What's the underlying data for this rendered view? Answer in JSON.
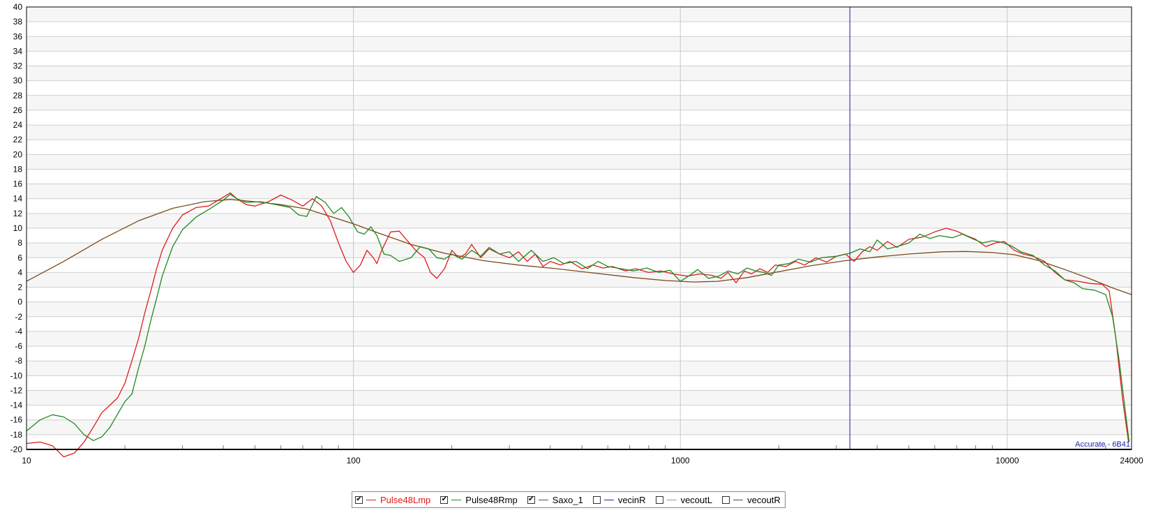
{
  "chart_data": {
    "type": "line",
    "title": "",
    "xlabel": "",
    "ylabel": "",
    "x_scale": "log",
    "xlim": [
      10,
      24000
    ],
    "ylim": [
      -20,
      40
    ],
    "grid": true,
    "x_ticks": [
      "10",
      "100",
      "1000",
      "10000",
      "24000"
    ],
    "y_ticks": [
      "40",
      "38",
      "36",
      "34",
      "32",
      "30",
      "28",
      "26",
      "24",
      "22",
      "20",
      "18",
      "16",
      "14",
      "12",
      "10",
      "8",
      "6",
      "4",
      "2",
      "0",
      "-2",
      "-4",
      "-6",
      "-8",
      "-10",
      "-12",
      "-14",
      "-16",
      "-18",
      "-20"
    ],
    "cursor_x": 3300,
    "watermark": "Accurate - 6B41",
    "series": [
      {
        "name": "Pulse48Lmp",
        "color": "#e01b1b",
        "checked": true,
        "points": [
          [
            10,
            -19.2
          ],
          [
            11,
            -19
          ],
          [
            12,
            -19.5
          ],
          [
            13,
            -21
          ],
          [
            14,
            -20.5
          ],
          [
            15,
            -19
          ],
          [
            16,
            -17
          ],
          [
            17,
            -15
          ],
          [
            18,
            -14
          ],
          [
            19,
            -13
          ],
          [
            20,
            -11
          ],
          [
            21,
            -8
          ],
          [
            22,
            -5
          ],
          [
            23,
            -1.5
          ],
          [
            24,
            1.5
          ],
          [
            25,
            4.5
          ],
          [
            26,
            7
          ],
          [
            28,
            10
          ],
          [
            30,
            11.8
          ],
          [
            33,
            12.8
          ],
          [
            36,
            13
          ],
          [
            40,
            14.2
          ],
          [
            42,
            14.8
          ],
          [
            44,
            14
          ],
          [
            47,
            13.2
          ],
          [
            50,
            13
          ],
          [
            55,
            13.6
          ],
          [
            60,
            14.5
          ],
          [
            65,
            13.8
          ],
          [
            70,
            13
          ],
          [
            75,
            14
          ],
          [
            80,
            13
          ],
          [
            85,
            11
          ],
          [
            90,
            8
          ],
          [
            95,
            5.5
          ],
          [
            100,
            4
          ],
          [
            105,
            5
          ],
          [
            110,
            7
          ],
          [
            115,
            6
          ],
          [
            118,
            5.2
          ],
          [
            122,
            7
          ],
          [
            130,
            9.5
          ],
          [
            138,
            9.6
          ],
          [
            145,
            8.5
          ],
          [
            155,
            7
          ],
          [
            165,
            6
          ],
          [
            172,
            4
          ],
          [
            180,
            3.2
          ],
          [
            190,
            4.5
          ],
          [
            200,
            7
          ],
          [
            210,
            6
          ],
          [
            220,
            6.5
          ],
          [
            230,
            7.8
          ],
          [
            245,
            6
          ],
          [
            260,
            7.2
          ],
          [
            280,
            6.5
          ],
          [
            300,
            6
          ],
          [
            320,
            6.8
          ],
          [
            340,
            5.5
          ],
          [
            360,
            6.5
          ],
          [
            380,
            4.8
          ],
          [
            400,
            5.5
          ],
          [
            430,
            5
          ],
          [
            460,
            5.5
          ],
          [
            500,
            4.5
          ],
          [
            540,
            5
          ],
          [
            580,
            4.6
          ],
          [
            620,
            4.8
          ],
          [
            680,
            4.2
          ],
          [
            730,
            4.5
          ],
          [
            800,
            4
          ],
          [
            870,
            4.2
          ],
          [
            950,
            3.8
          ],
          [
            1050,
            3.5
          ],
          [
            1150,
            3.8
          ],
          [
            1250,
            3.6
          ],
          [
            1330,
            3.2
          ],
          [
            1400,
            4
          ],
          [
            1480,
            2.6
          ],
          [
            1570,
            4.2
          ],
          [
            1650,
            3.8
          ],
          [
            1750,
            4.5
          ],
          [
            1850,
            4
          ],
          [
            1950,
            5
          ],
          [
            2100,
            4.8
          ],
          [
            2250,
            5.5
          ],
          [
            2400,
            5
          ],
          [
            2600,
            6
          ],
          [
            2800,
            5.4
          ],
          [
            3000,
            6.2
          ],
          [
            3200,
            6.5
          ],
          [
            3400,
            5.5
          ],
          [
            3600,
            6.8
          ],
          [
            3800,
            7.5
          ],
          [
            4000,
            7
          ],
          [
            4300,
            8.2
          ],
          [
            4600,
            7.4
          ],
          [
            5000,
            8.5
          ],
          [
            5500,
            8.8
          ],
          [
            6000,
            9.5
          ],
          [
            6500,
            10
          ],
          [
            7000,
            9.6
          ],
          [
            7500,
            9
          ],
          [
            8000,
            8.5
          ],
          [
            8600,
            7.5
          ],
          [
            9200,
            8
          ],
          [
            9800,
            8.2
          ],
          [
            10500,
            7
          ],
          [
            11200,
            6.5
          ],
          [
            12000,
            6.2
          ],
          [
            13000,
            5.5
          ],
          [
            14000,
            4
          ],
          [
            15000,
            3
          ],
          [
            16500,
            2.8
          ],
          [
            18000,
            2.5
          ],
          [
            19500,
            2.4
          ],
          [
            20500,
            1.5
          ],
          [
            21500,
            -5
          ],
          [
            22500,
            -13
          ],
          [
            23500,
            -19
          ]
        ]
      },
      {
        "name": "Pulse48Rmp",
        "color": "#1e8a1e",
        "checked": true,
        "points": [
          [
            10,
            -17.5
          ],
          [
            11,
            -16
          ],
          [
            12,
            -15.3
          ],
          [
            13,
            -15.6
          ],
          [
            14,
            -16.5
          ],
          [
            15,
            -18
          ],
          [
            16,
            -18.8
          ],
          [
            17,
            -18.3
          ],
          [
            18,
            -17
          ],
          [
            19,
            -15.2
          ],
          [
            20,
            -13.5
          ],
          [
            21,
            -12.5
          ],
          [
            22,
            -9
          ],
          [
            23,
            -6
          ],
          [
            24,
            -2.5
          ],
          [
            25,
            0.5
          ],
          [
            26,
            3.5
          ],
          [
            28,
            7.5
          ],
          [
            30,
            9.8
          ],
          [
            33,
            11.5
          ],
          [
            36,
            12.5
          ],
          [
            40,
            13.8
          ],
          [
            42,
            14.6
          ],
          [
            44,
            14
          ],
          [
            47,
            13.5
          ],
          [
            52,
            13.6
          ],
          [
            58,
            13.2
          ],
          [
            64,
            12.8
          ],
          [
            68,
            11.8
          ],
          [
            72,
            11.6
          ],
          [
            77,
            14.3
          ],
          [
            82,
            13.5
          ],
          [
            87,
            12
          ],
          [
            92,
            12.8
          ],
          [
            97,
            11.5
          ],
          [
            103,
            9.5
          ],
          [
            108,
            9.2
          ],
          [
            113,
            10.2
          ],
          [
            118,
            9
          ],
          [
            124,
            6.5
          ],
          [
            130,
            6.3
          ],
          [
            138,
            5.5
          ],
          [
            150,
            6
          ],
          [
            160,
            7.5
          ],
          [
            170,
            7.2
          ],
          [
            180,
            6
          ],
          [
            190,
            5.8
          ],
          [
            200,
            6.5
          ],
          [
            215,
            5.8
          ],
          [
            230,
            7
          ],
          [
            245,
            6.2
          ],
          [
            260,
            7.4
          ],
          [
            280,
            6.5
          ],
          [
            300,
            6.8
          ],
          [
            320,
            5.5
          ],
          [
            350,
            7
          ],
          [
            380,
            5.5
          ],
          [
            410,
            6
          ],
          [
            440,
            5.2
          ],
          [
            480,
            5.5
          ],
          [
            520,
            4.5
          ],
          [
            560,
            5.5
          ],
          [
            600,
            4.8
          ],
          [
            660,
            4.5
          ],
          [
            720,
            4.2
          ],
          [
            790,
            4.6
          ],
          [
            860,
            4
          ],
          [
            930,
            4.3
          ],
          [
            1000,
            2.8
          ],
          [
            1060,
            3.5
          ],
          [
            1130,
            4.4
          ],
          [
            1220,
            3.2
          ],
          [
            1310,
            3.5
          ],
          [
            1400,
            4.2
          ],
          [
            1500,
            3.8
          ],
          [
            1600,
            4.6
          ],
          [
            1700,
            4.2
          ],
          [
            1800,
            4
          ],
          [
            1900,
            3.6
          ],
          [
            2000,
            5
          ],
          [
            2150,
            5.2
          ],
          [
            2300,
            5.8
          ],
          [
            2500,
            5.4
          ],
          [
            2700,
            6
          ],
          [
            3000,
            6.2
          ],
          [
            3300,
            6.6
          ],
          [
            3550,
            7.2
          ],
          [
            3800,
            6.8
          ],
          [
            4000,
            8.4
          ],
          [
            4300,
            7.2
          ],
          [
            4600,
            7.5
          ],
          [
            5000,
            8
          ],
          [
            5400,
            9.2
          ],
          [
            5800,
            8.6
          ],
          [
            6200,
            9
          ],
          [
            6800,
            8.7
          ],
          [
            7300,
            9.2
          ],
          [
            7800,
            8.6
          ],
          [
            8400,
            8
          ],
          [
            9000,
            8.3
          ],
          [
            9600,
            8.1
          ],
          [
            10300,
            7.6
          ],
          [
            11000,
            6.8
          ],
          [
            12000,
            6.3
          ],
          [
            13000,
            5
          ],
          [
            14000,
            4.2
          ],
          [
            15000,
            3
          ],
          [
            16000,
            2.6
          ],
          [
            17000,
            1.8
          ],
          [
            18500,
            1.6
          ],
          [
            20000,
            1
          ],
          [
            21000,
            -2
          ],
          [
            22000,
            -8
          ],
          [
            23000,
            -15
          ],
          [
            23600,
            -19
          ]
        ]
      },
      {
        "name": "Saxo_1",
        "color": "#7a4a1a",
        "checked": true,
        "points": [
          [
            10,
            2.8
          ],
          [
            13,
            5.5
          ],
          [
            17,
            8.5
          ],
          [
            22,
            11
          ],
          [
            28,
            12.7
          ],
          [
            35,
            13.6
          ],
          [
            42,
            13.9
          ],
          [
            50,
            13.6
          ],
          [
            60,
            13.2
          ],
          [
            72,
            12.6
          ],
          [
            85,
            11.6
          ],
          [
            100,
            10.6
          ],
          [
            120,
            9.3
          ],
          [
            150,
            7.8
          ],
          [
            190,
            6.6
          ],
          [
            250,
            5.6
          ],
          [
            320,
            5
          ],
          [
            420,
            4.5
          ],
          [
            550,
            3.9
          ],
          [
            720,
            3.3
          ],
          [
            900,
            2.9
          ],
          [
            1100,
            2.7
          ],
          [
            1300,
            2.8
          ],
          [
            1600,
            3.3
          ],
          [
            2000,
            4.1
          ],
          [
            2500,
            4.9
          ],
          [
            3200,
            5.6
          ],
          [
            4000,
            6.1
          ],
          [
            5000,
            6.5
          ],
          [
            6300,
            6.8
          ],
          [
            7500,
            6.85
          ],
          [
            9000,
            6.7
          ],
          [
            10500,
            6.4
          ],
          [
            12500,
            5.6
          ],
          [
            15000,
            4.4
          ],
          [
            18000,
            3.1
          ],
          [
            21000,
            1.9
          ],
          [
            24000,
            1
          ]
        ]
      },
      {
        "name": "vecinR",
        "color": "#2222aa",
        "checked": false,
        "points": []
      },
      {
        "name": "vecoutL",
        "color": "#66aaaa",
        "checked": false,
        "points": []
      },
      {
        "name": "vecoutR",
        "color": "#444466",
        "checked": false,
        "points": []
      }
    ]
  }
}
